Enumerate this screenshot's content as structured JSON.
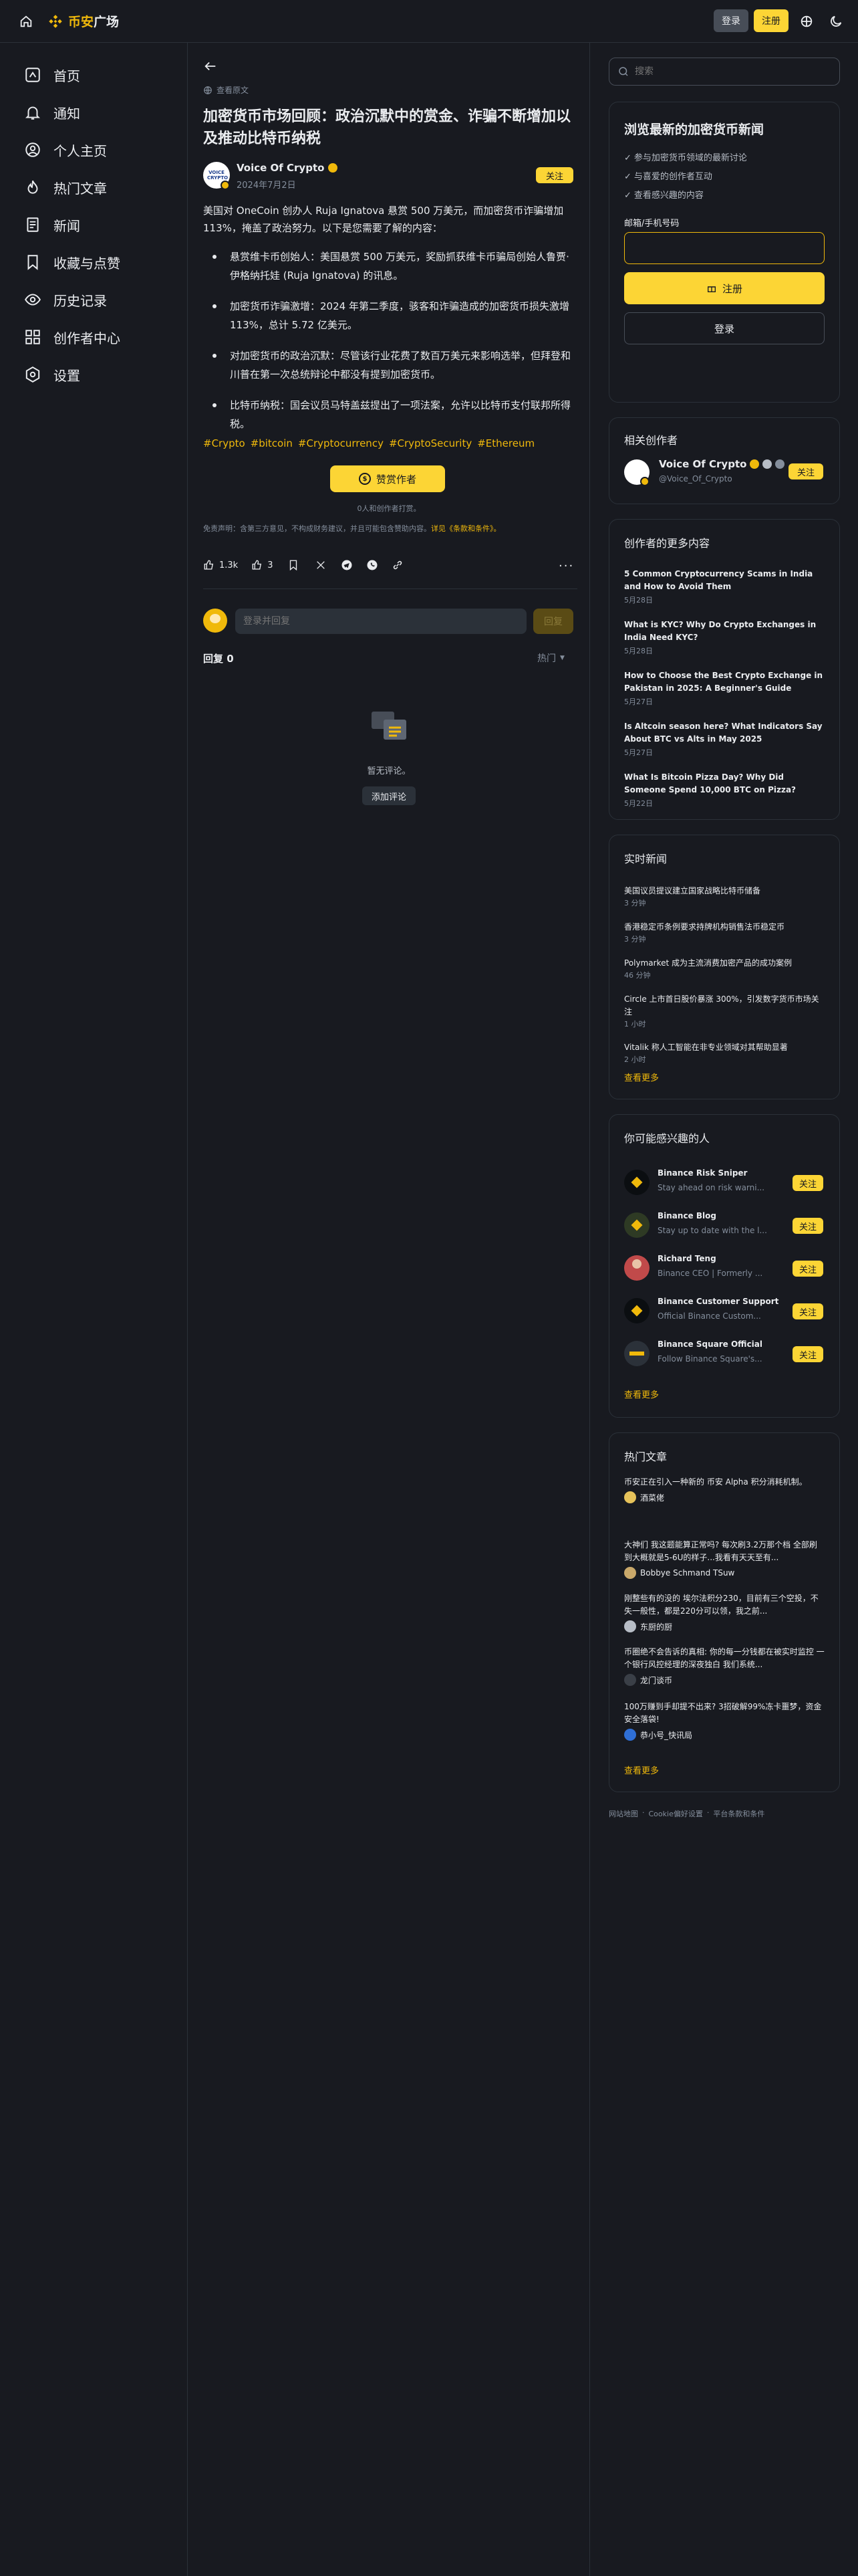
{
  "topbar": {
    "logo_text_a": "币安",
    "logo_text_b": "广场",
    "login": "登录",
    "register": "注册"
  },
  "nav": [
    {
      "label": "首页",
      "icon": "home-square-icon"
    },
    {
      "label": "通知",
      "icon": "bell-icon"
    },
    {
      "label": "个人主页",
      "icon": "user-icon"
    },
    {
      "label": "热门文章",
      "icon": "fire-icon"
    },
    {
      "label": "新闻",
      "icon": "news-icon"
    },
    {
      "label": "收藏与点赞",
      "icon": "bookmark-icon"
    },
    {
      "label": "历史记录",
      "icon": "eye-icon"
    },
    {
      "label": "创作者中心",
      "icon": "grid-icon"
    },
    {
      "label": "设置",
      "icon": "settings-icon"
    }
  ],
  "article": {
    "translate_label": "查看原文",
    "title": "加密货币市场回顾：政治沉默中的赏金、诈骗不断增加以及推动比特币纳税",
    "author": "Voice Of Crypto",
    "date": "2024年7月2日",
    "follow": "关注",
    "intro": "美国对 OneCoin 创办人 Ruja Ignatova 悬赏 500 万美元，而加密货币诈骗增加 113%，掩盖了政治努力。以下是您需要了解的内容：",
    "bullets": [
      "悬赏维卡币创始人：美国悬赏 500 万美元，奖励抓获维卡币骗局创始人鲁贾·伊格纳托娃 (Ruja Ignatova) 的讯息。",
      "加密货币诈骗激增：2024 年第二季度，骇客和诈骗造成的加密货币损失激增 113%，总计 5.72 亿美元。",
      "对加密货币的政治沉默：尽管该行业花费了数百万美元来影响选举，但拜登和川普在第一次总统辩论中都没有提到加密货币。",
      "比特币纳税：国会议员马特盖兹提出了一项法案，允许以比特币支付联邦所得税。"
    ],
    "tags": [
      "#Crypto",
      "#bitcoin",
      "#Cryptocurrency",
      "#CryptoSecurity",
      "#Ethereum"
    ],
    "tip_button": "赞赏作者",
    "tip_note": "0人和创作者打赏。",
    "disclaimer_a": "免责声明：含第三方意见，不构成财务建议，并且可能包含赞助内容。",
    "disclaimer_link": "详见《条款和条件》。",
    "likes": "1.3k",
    "quotes": "3"
  },
  "comments": {
    "placeholder": "登录并回复",
    "reply_btn": "回复",
    "count_label": "回复 0",
    "sort": "热门",
    "empty": "暂无评论。",
    "add": "添加评论"
  },
  "right": {
    "search_placeholder": "搜索",
    "signup": {
      "title": "浏览最新的加密货币新闻",
      "points": [
        "参与加密货币领域的最新讨论",
        "与喜爱的创作者互动",
        "查看感兴趣的内容"
      ],
      "field_label": "邮箱/手机号码",
      "register": "注册",
      "login": "登录"
    },
    "related": {
      "title": "相关创作者",
      "name": "Voice Of Crypto",
      "handle": "@Voice_Of_Crypto",
      "follow": "关注"
    },
    "more": {
      "title": "创作者的更多内容",
      "items": [
        {
          "title": "5 Common Cryptocurrency Scams in India and How to Avoid Them",
          "date": "5月28日"
        },
        {
          "title": "What is KYC? Why Do Crypto Exchanges in India Need KYC?",
          "date": "5月28日"
        },
        {
          "title": "How to Choose the Best Crypto Exchange in Pakistan in 2025: A Beginner's Guide",
          "date": "5月27日"
        },
        {
          "title": "Is Altcoin season here? What Indicators Say About BTC vs Alts in May 2025",
          "date": "5月27日"
        },
        {
          "title": "What Is Bitcoin Pizza Day? Why Did Someone Spend 10,000 BTC on Pizza?",
          "date": "5月22日"
        }
      ]
    },
    "news": {
      "title": "实时新闻",
      "items": [
        {
          "title": "美国议员提议建立国家战略比特币储备",
          "time": "3 分钟"
        },
        {
          "title": "香港稳定币条例要求持牌机构销售法币稳定币",
          "time": "3 分钟"
        },
        {
          "title": "Polymarket 成为主流消费加密产品的成功案例",
          "time": "46 分钟"
        },
        {
          "title": "Circle 上市首日股价暴涨 300%，引发数字货币市场关注",
          "time": "1 小时"
        },
        {
          "title": "Vitalik 称人工智能在非专业领域对其帮助显著",
          "time": "2 小时"
        }
      ],
      "see_more": "查看更多"
    },
    "people": {
      "title": "你可能感兴趣的人",
      "items": [
        {
          "name": "Binance Risk Sniper",
          "desc": "Stay ahead on risk warni..."
        },
        {
          "name": "Binance Blog",
          "desc": "Stay up to date with the l..."
        },
        {
          "name": "Richard Teng",
          "desc": "Binance CEO | Formerly ..."
        },
        {
          "name": "Binance Customer Support",
          "desc": "Official Binance Custom..."
        },
        {
          "name": "Binance Square Official",
          "desc": "Follow Binance Square's..."
        }
      ],
      "follow": "关注",
      "see_more": "查看更多"
    },
    "hot": {
      "title": "热门文章",
      "items": [
        {
          "title": "币安正在引入一种新的 币安 Alpha 积分消耗机制。",
          "author": "酒菜佬"
        },
        {
          "title": "大神们 我这题能算正常吗? 每次刷3.2万那个档 全部刷到大概就是5-6U的样子...我看有天天至有...",
          "author": "Bobbye Schmand TSuw"
        },
        {
          "title": "刚整些有的没的 埃尔法积分230，目前有三个空投，不失一般性，都是220分可以领，我之前...",
          "author": "东厨的厨"
        },
        {
          "title": "币圈绝不会告诉的真相: 你的每一分钱都在被实时监控 一个银行风控经理的深夜独白 我们系统...",
          "author": "龙门谈币"
        },
        {
          "title": "100万赚到手却提不出来? 3招破解99%冻卡噩梦，资金安全落袋!",
          "author": "恭小号_快讯局"
        }
      ],
      "see_more": "查看更多"
    },
    "footer": [
      "网站地图",
      "Cookie偏好设置",
      "平台条款和条件"
    ]
  }
}
